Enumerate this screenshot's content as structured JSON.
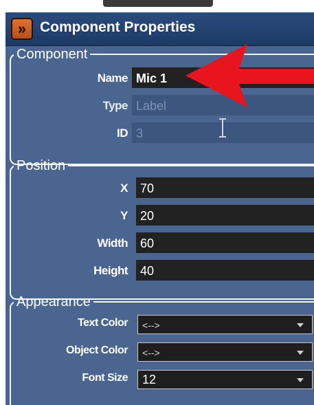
{
  "panel": {
    "title": "Component Properties",
    "expand_icon": "double-chevron-right-icon"
  },
  "component": {
    "legend": "Component",
    "name_label": "Name",
    "name_value": "Mic 1",
    "type_label": "Type",
    "type_value": "Label",
    "id_label": "ID",
    "id_value": "3"
  },
  "position": {
    "legend": "Position",
    "x_label": "X",
    "x_value": "70",
    "y_label": "Y",
    "y_value": "20",
    "width_label": "Width",
    "width_value": "60",
    "height_label": "Height",
    "height_value": "40"
  },
  "appearance": {
    "legend": "Appearance",
    "text_color_label": "Text Color",
    "text_color_value": "<-->",
    "object_color_label": "Object Color",
    "object_color_value": "<-->",
    "font_size_label": "Font Size",
    "font_size_value": "12"
  },
  "colors": {
    "panel_bg": "#4a6690",
    "titlebar_bg": "#1d3a66",
    "accent_button": "#d4652a",
    "arrow": "#e8141e"
  },
  "icons": {
    "cursor": "text-cursor-icon",
    "dropdown": "dropdown-arrow-icon",
    "annotation": "red-arrow-icon"
  }
}
